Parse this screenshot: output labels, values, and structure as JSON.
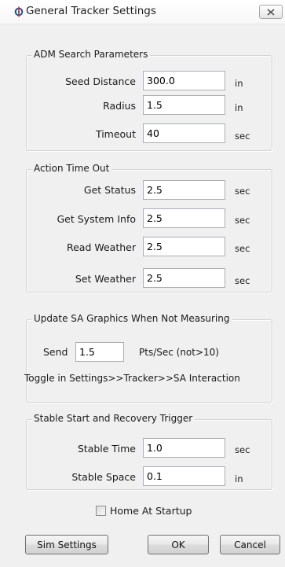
{
  "window": {
    "title": "General Tracker Settings"
  },
  "adm": {
    "title": "ADM Search Parameters",
    "seed_distance": {
      "label": "Seed Distance",
      "value": "300.0",
      "unit": "in"
    },
    "radius": {
      "label": "Radius",
      "value": "1.5",
      "unit": "in"
    },
    "timeout": {
      "label": "Timeout",
      "value": "40",
      "unit": "sec"
    }
  },
  "action": {
    "title": "Action Time Out",
    "get_status": {
      "label": "Get Status",
      "value": "2.5",
      "unit": "sec"
    },
    "get_system_info": {
      "label": "Get System Info",
      "value": "2.5",
      "unit": "sec"
    },
    "read_weather": {
      "label": "Read Weather",
      "value": "2.5",
      "unit": "sec"
    },
    "set_weather": {
      "label": "Set Weather",
      "value": "2.5",
      "unit": "sec"
    }
  },
  "update": {
    "title": "Update SA Graphics When Not Measuring",
    "send_label": "Send",
    "send_value": "1.5",
    "send_unit": "Pts/Sec (not>10)",
    "toggle_note": "Toggle in Settings>>Tracker>>SA Interaction"
  },
  "stable": {
    "title": "Stable Start and Recovery Trigger",
    "time": {
      "label": "Stable Time",
      "value": "1.0",
      "unit": "sec"
    },
    "space": {
      "label": "Stable Space",
      "value": "0.1",
      "unit": "in"
    }
  },
  "home_at_startup": {
    "label": "Home At Startup",
    "checked": false
  },
  "buttons": {
    "sim_settings": "Sim Settings",
    "ok": "OK",
    "cancel": "Cancel"
  }
}
